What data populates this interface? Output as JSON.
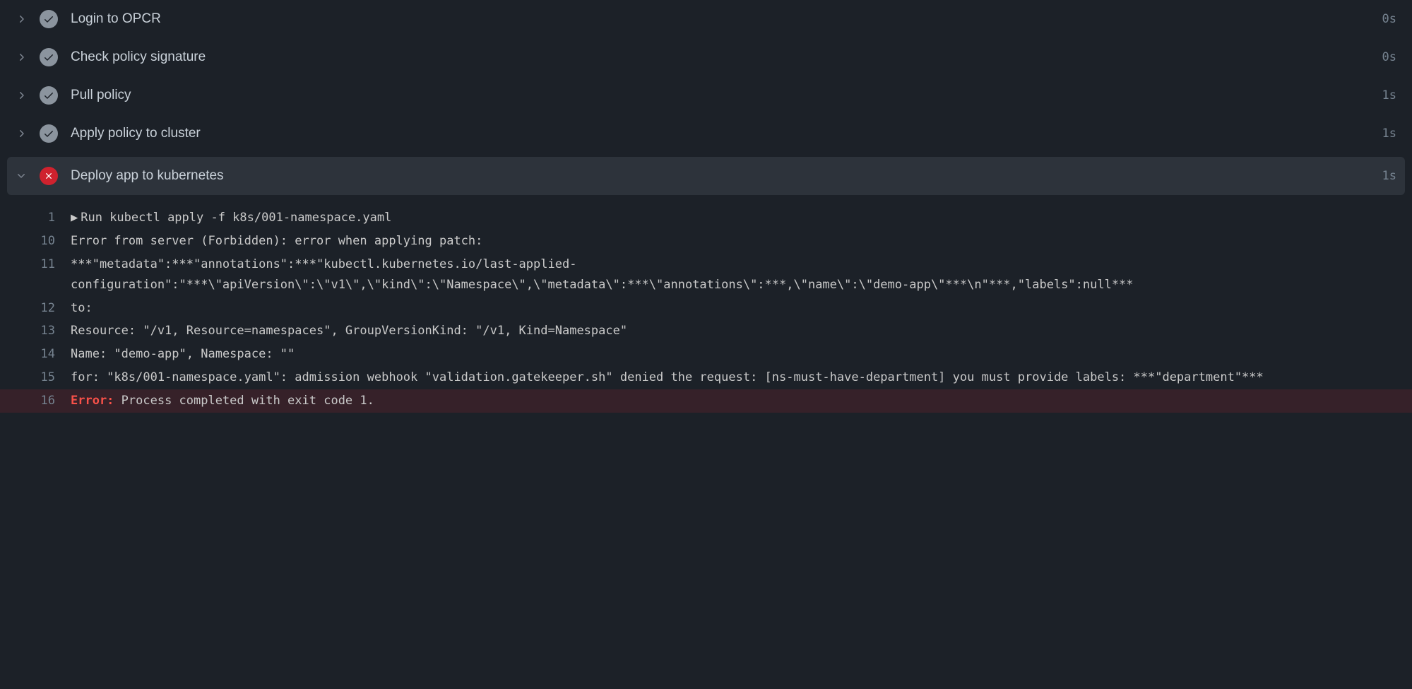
{
  "steps": [
    {
      "label": "Login to OPCR",
      "status": "success",
      "duration": "0s",
      "expanded": false
    },
    {
      "label": "Check policy signature",
      "status": "success",
      "duration": "0s",
      "expanded": false
    },
    {
      "label": "Pull policy",
      "status": "success",
      "duration": "1s",
      "expanded": false
    },
    {
      "label": "Apply policy to cluster",
      "status": "success",
      "duration": "1s",
      "expanded": false
    },
    {
      "label": "Deploy app to kubernetes",
      "status": "error",
      "duration": "1s",
      "expanded": true
    }
  ],
  "log": {
    "lines": [
      {
        "num": "1",
        "content": "Run kubectl apply -f k8s/001-namespace.yaml",
        "hasRunMarker": true
      },
      {
        "num": "10",
        "content": "Error from server (Forbidden): error when applying patch:"
      },
      {
        "num": "11",
        "content": "***\"metadata\":***\"annotations\":***\"kubectl.kubernetes.io/last-applied-configuration\":\"***\\\"apiVersion\\\":\\\"v1\\\",\\\"kind\\\":\\\"Namespace\\\",\\\"metadata\\\":***\\\"annotations\\\":***,\\\"name\\\":\\\"demo-app\\\"***\\n\"***,\"labels\":null***"
      },
      {
        "num": "12",
        "content": "to:"
      },
      {
        "num": "13",
        "content": "Resource: \"/v1, Resource=namespaces\", GroupVersionKind: \"/v1, Kind=Namespace\""
      },
      {
        "num": "14",
        "content": "Name: \"demo-app\", Namespace: \"\""
      },
      {
        "num": "15",
        "content": "for: \"k8s/001-namespace.yaml\": admission webhook \"validation.gatekeeper.sh\" denied the request: [ns-must-have-department] you must provide labels: ***\"department\"***"
      },
      {
        "num": "16",
        "content": "Process completed with exit code 1.",
        "isError": true,
        "errorPrefix": "Error: "
      }
    ]
  }
}
